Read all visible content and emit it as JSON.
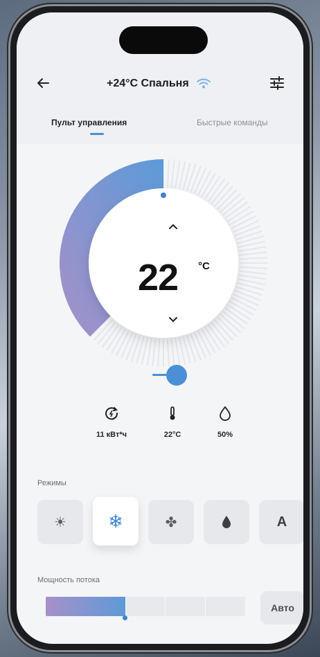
{
  "header": {
    "title": "+24°C Спальня"
  },
  "tabs": [
    {
      "label": "Пульт управления",
      "active": true
    },
    {
      "label": "Быстрые команды",
      "active": false
    }
  ],
  "thermostat": {
    "temperature": "22",
    "unit": "°C",
    "level": 0.38
  },
  "stats": [
    {
      "icon": "energy-icon",
      "value": "11 кВт*ч"
    },
    {
      "icon": "thermometer-icon",
      "value": "22°C"
    },
    {
      "icon": "humidity-drop-icon",
      "value": "50%"
    }
  ],
  "modes": {
    "label": "Режимы",
    "items": [
      {
        "icon": "sun-icon",
        "glyph": "☀",
        "active": false
      },
      {
        "icon": "snowflake-icon",
        "glyph": "❄",
        "active": true
      },
      {
        "icon": "fan-icon",
        "glyph": "✤",
        "active": false
      },
      {
        "icon": "drop-icon",
        "glyph": "●",
        "active": false
      },
      {
        "icon": "auto-icon",
        "glyph": "A",
        "active": false
      }
    ]
  },
  "flow": {
    "label": "Мощность потока",
    "level": 0.4,
    "auto_label": "Авто"
  },
  "colors": {
    "accent": "#4b8fd6",
    "gradient_start": "#a890c8",
    "gradient_end": "#5c9ad8"
  }
}
